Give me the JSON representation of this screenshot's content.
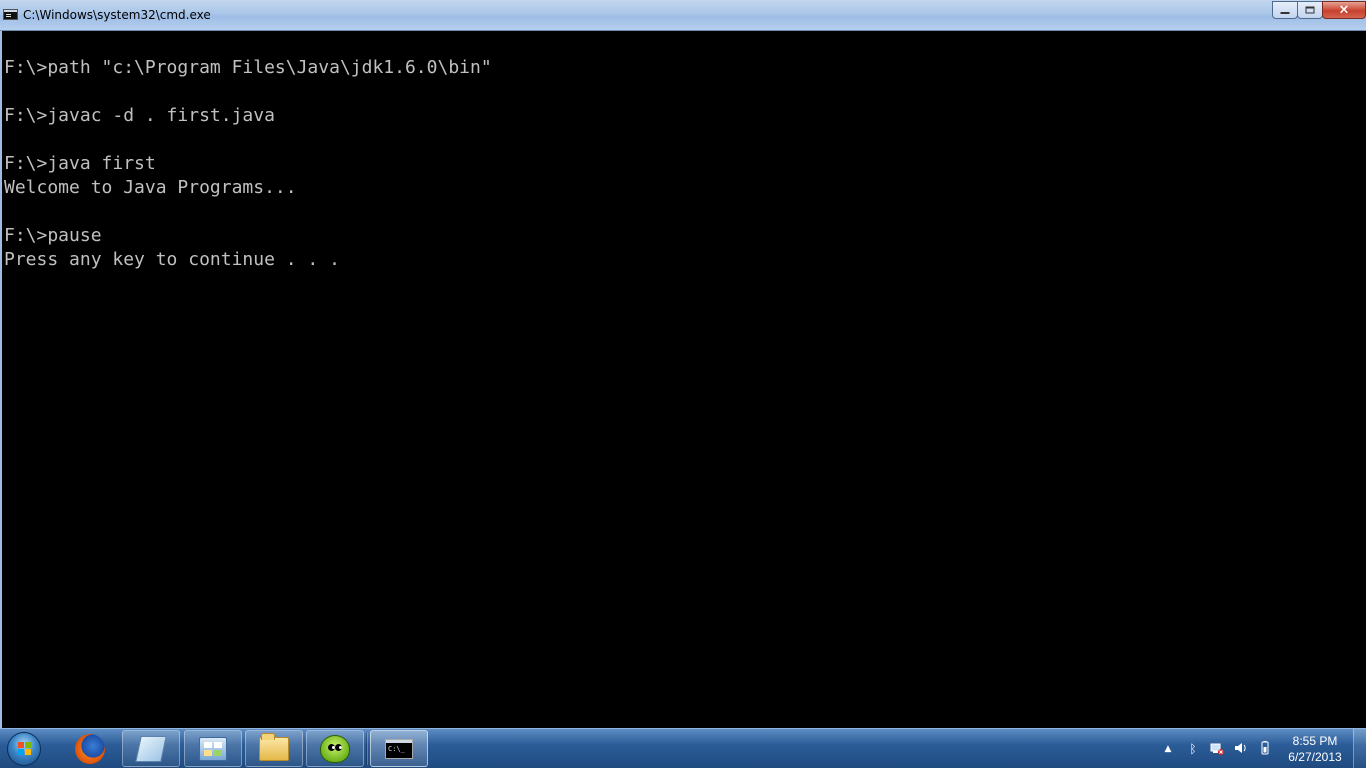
{
  "window": {
    "title": "C:\\Windows\\system32\\cmd.exe",
    "icon": "cmd-icon",
    "controls": {
      "minimize": "minimize-icon",
      "maximize": "maximize-icon",
      "close": "×"
    }
  },
  "console": {
    "lines": [
      "",
      "F:\\>path \"c:\\Program Files\\Java\\jdk1.6.0\\bin\"",
      "",
      "F:\\>javac -d . first.java",
      "",
      "F:\\>java first",
      "Welcome to Java Programs...",
      "",
      "F:\\>pause",
      "Press any key to continue . . ."
    ],
    "colors": {
      "background": "#000000",
      "text": "#c0c0c0"
    }
  },
  "taskbar": {
    "start_icon": "windows-start-orb-icon",
    "apps": [
      {
        "name": "firefox",
        "icon": "firefox-icon"
      },
      {
        "name": "notepad",
        "icon": "pen-notepad-icon"
      },
      {
        "name": "control-panel",
        "icon": "control-panel-icon"
      },
      {
        "name": "explorer",
        "icon": "folder-icon"
      },
      {
        "name": "green-app",
        "icon": "green-character-icon"
      },
      {
        "name": "cmd",
        "icon": "cmd-icon",
        "active": true
      }
    ],
    "tray": {
      "icons": [
        "show-hidden-icons-arrow-icon",
        "bluetooth-icon",
        "network-icon",
        "volume-icon",
        "battery-icon"
      ],
      "time": "8:55 PM",
      "date": "6/27/2013"
    }
  }
}
